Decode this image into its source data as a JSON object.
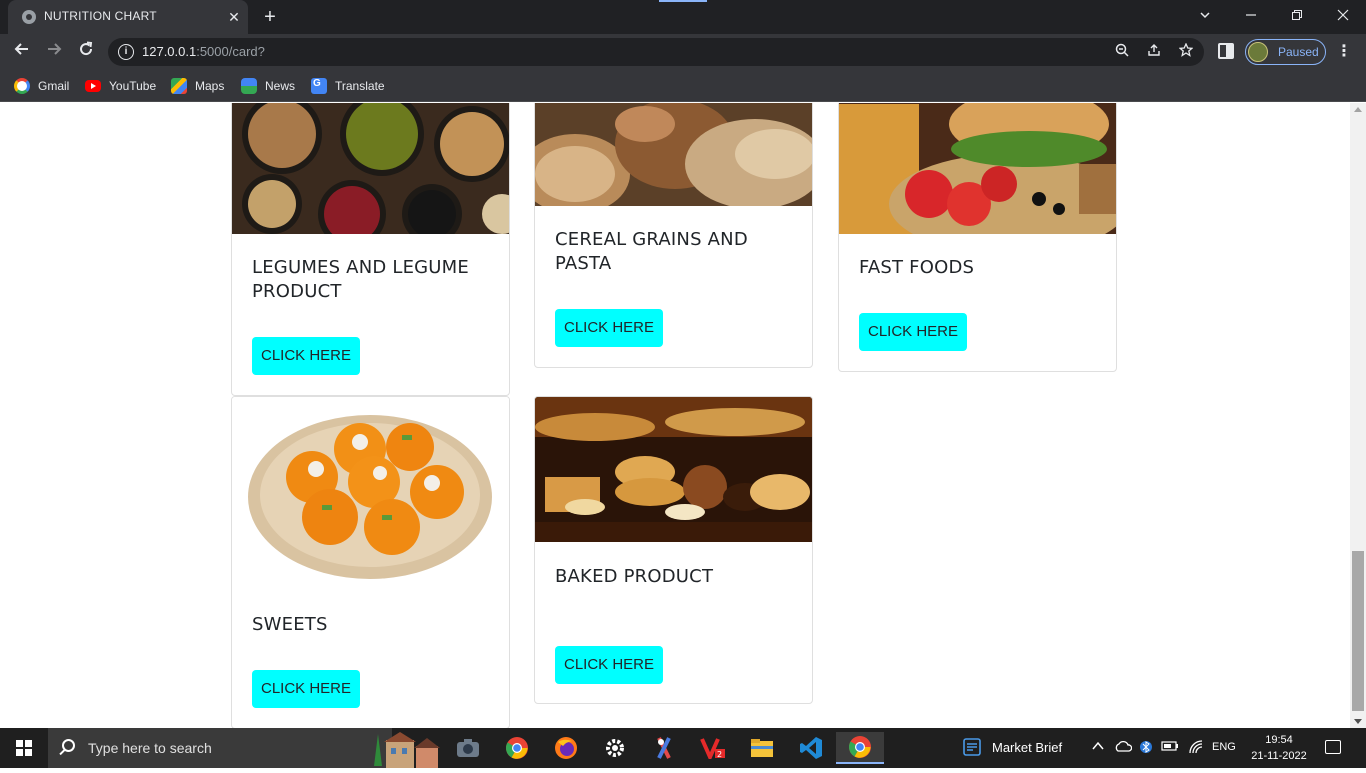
{
  "browser": {
    "tab_title": "NUTRITION CHART",
    "tab_close": "✕",
    "new_tab": "+",
    "url_host": "127.0.0.1",
    "url_rest": ":5000/card?",
    "profile_status": "Paused",
    "bookmarks": [
      "Gmail",
      "YouTube",
      "Maps",
      "News",
      "Translate"
    ]
  },
  "cards": [
    {
      "title": "LEGUMES AND LEGUME PRODUCT",
      "button": "CLICK HERE",
      "image": "legumes-image"
    },
    {
      "title": "CEREAL GRAINS AND PASTA",
      "button": "CLICK HERE",
      "image": "cereal-grains-image"
    },
    {
      "title": "FAST FOODS",
      "button": "CLICK HERE",
      "image": "fast-foods-image"
    },
    {
      "title": "SWEETS",
      "button": "CLICK HERE",
      "image": "sweets-image"
    },
    {
      "title": "BAKED PRODUCT",
      "button": "CLICK HERE",
      "image": "baked-product-image"
    }
  ],
  "taskbar": {
    "search_placeholder": "Type here to search",
    "widget_label": "Market Brief",
    "language": "ENG",
    "time": "19:54",
    "date": "21-11-2022"
  },
  "colors": {
    "button_bg": "#00ffff",
    "chrome_dark": "#202124",
    "chrome_mid": "#35363a",
    "accent": "#8ab4f8"
  }
}
